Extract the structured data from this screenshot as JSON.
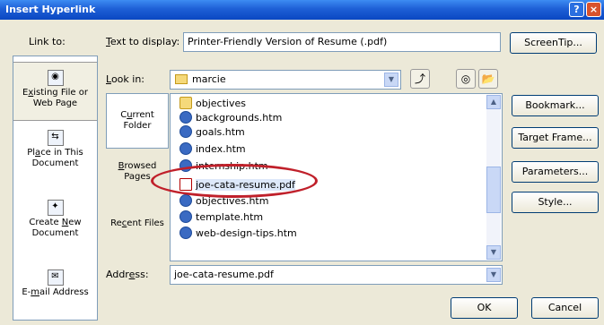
{
  "window": {
    "title": "Insert Hyperlink",
    "help_icon": "?",
    "close_icon": "×"
  },
  "link_to": {
    "label": "Link to:",
    "items": [
      {
        "icon": "web-page-icon",
        "label_pre": "E",
        "label_u": "x",
        "label_post": "isting File or Web Page"
      },
      {
        "icon": "document-place-icon",
        "label_pre": "Pl",
        "label_u": "a",
        "label_post": "ce in This Document"
      },
      {
        "icon": "new-document-icon",
        "label_pre": "Create ",
        "label_u": "N",
        "label_post": "ew Document"
      },
      {
        "icon": "email-icon",
        "label_pre": "E-",
        "label_u": "m",
        "label_post": "ail Address"
      }
    ]
  },
  "text_to_display": {
    "label_u": "T",
    "label_rest": "ext to display:",
    "value": "Printer-Friendly Version of Resume (.pdf)"
  },
  "look_in": {
    "label_u": "L",
    "label_rest": "ook in:",
    "value": "marcie"
  },
  "locations": [
    {
      "pre": "C",
      "u": "u",
      "post": "rrent Folder"
    },
    {
      "pre": "",
      "u": "B",
      "post": "rowsed Pages"
    },
    {
      "pre": "Re",
      "u": "c",
      "post": "ent Files"
    }
  ],
  "files": [
    {
      "name": "objectives",
      "type": "folder"
    },
    {
      "name": "backgrounds.htm",
      "type": "htm"
    },
    {
      "name": "goals.htm",
      "type": "htm"
    },
    {
      "name": "index.htm",
      "type": "htm"
    },
    {
      "name": "internship.htm",
      "type": "htm"
    },
    {
      "name": "joe-cata-resume.pdf",
      "type": "pdf",
      "selected": true
    },
    {
      "name": "objectives.htm",
      "type": "htm"
    },
    {
      "name": "template.htm",
      "type": "htm"
    },
    {
      "name": "web-design-tips.htm",
      "type": "htm"
    }
  ],
  "address": {
    "label_pre": "Addr",
    "label_u": "e",
    "label_post": "ss:",
    "value": "joe-cata-resume.pdf"
  },
  "buttons": {
    "screentip": "ScreenTip...",
    "bookmark": "Bookmark...",
    "target_frame": "Target Frame...",
    "parameters": "Parameters...",
    "style": "Style...",
    "ok": "OK",
    "cancel": "Cancel"
  },
  "colors": {
    "titlebar": "#1e5fd6",
    "annotation": "#c0202a",
    "selection": "#dde8fa"
  }
}
